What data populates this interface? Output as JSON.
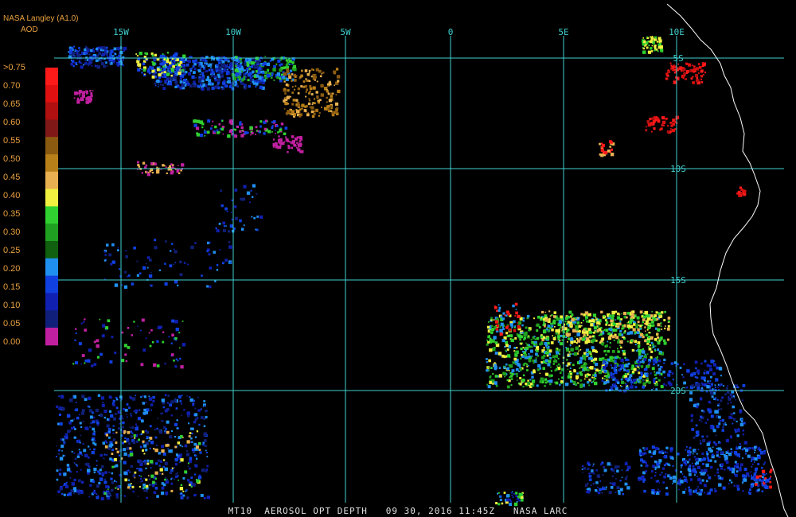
{
  "header": {
    "credit": "NASA Langley (A1.0)",
    "quantity": "AOD"
  },
  "footer": {
    "caption": "MT10  AEROSOL OPT DEPTH   09 30, 2016 11:45Z   NASA LARC"
  },
  "legend": {
    "labels": [
      ">0.75",
      "0.70",
      "0.65",
      "0.60",
      "0.55",
      "0.50",
      "0.45",
      "0.40",
      "0.35",
      "0.30",
      "0.25",
      "0.20",
      "0.15",
      "0.10",
      "0.05",
      "0.00"
    ],
    "colors": [
      "#ff1a1a",
      "#e01010",
      "#b01010",
      "#801818",
      "#8a5a10",
      "#b88018",
      "#e8b050",
      "#f0f040",
      "#30d030",
      "#20a020",
      "#106010",
      "#2090f0",
      "#1040e0",
      "#1020b0",
      "#10207a",
      "#c020a0"
    ]
  },
  "grid": {
    "longitude_labels": [
      "15W",
      "10W",
      "5W",
      "0",
      "5E",
      "10E"
    ],
    "latitude_labels": [
      "5S",
      "10S",
      "15S",
      "20S"
    ],
    "line_color": "#40d0d0",
    "label_color": "#40d0d0"
  },
  "colors": {
    "coastline": "#ffffff",
    "background": "#000000",
    "text": "#e8a040"
  }
}
